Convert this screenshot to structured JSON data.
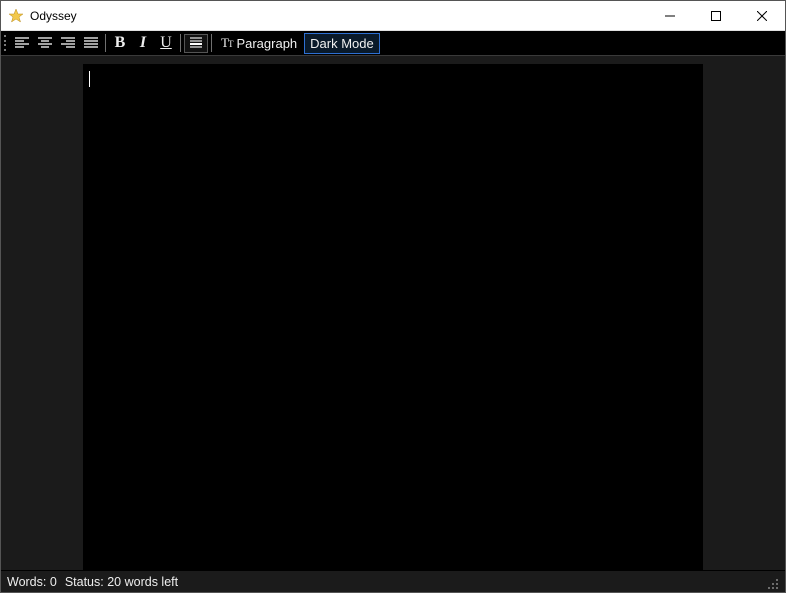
{
  "window": {
    "title": "Odyssey"
  },
  "toolbar": {
    "paragraph_label": "Paragraph",
    "dark_mode_label": "Dark Mode"
  },
  "statusbar": {
    "words_label": "Words:",
    "words_value": "0",
    "status_label": "Status:",
    "status_value": "20 words left"
  }
}
